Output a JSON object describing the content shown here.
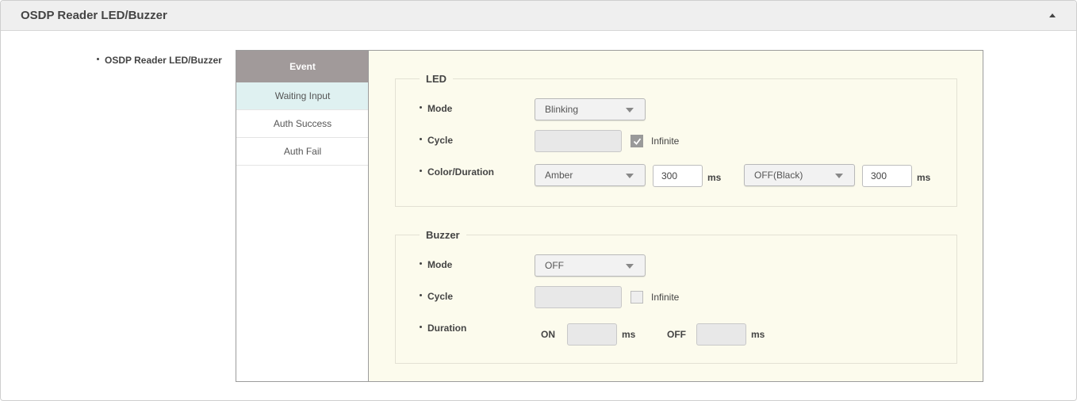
{
  "panel": {
    "title": "OSDP Reader LED/Buzzer"
  },
  "section": {
    "label": "OSDP Reader LED/Buzzer"
  },
  "events": {
    "header": "Event",
    "items": [
      {
        "label": "Waiting Input"
      },
      {
        "label": "Auth Success"
      },
      {
        "label": "Auth Fail"
      }
    ]
  },
  "led": {
    "legend": "LED",
    "mode_label": "Mode",
    "mode_value": "Blinking",
    "cycle_label": "Cycle",
    "cycle_value": "",
    "infinite_label": "Infinite",
    "infinite_checked": true,
    "color_label": "Color/Duration",
    "color1_value": "Amber",
    "duration1_value": "300",
    "color2_value": "OFF(Black)",
    "duration2_value": "300",
    "unit": "ms"
  },
  "buzzer": {
    "legend": "Buzzer",
    "mode_label": "Mode",
    "mode_value": "OFF",
    "cycle_label": "Cycle",
    "cycle_value": "",
    "infinite_label": "Infinite",
    "infinite_checked": false,
    "duration_label": "Duration",
    "on_label": "ON",
    "on_value": "",
    "off_label": "OFF",
    "off_value": "",
    "unit": "ms"
  },
  "colors": {
    "event_header_bg": "#a19a9a",
    "event_active_bg": "#dff1f1",
    "content_bg": "#fcfbed"
  }
}
